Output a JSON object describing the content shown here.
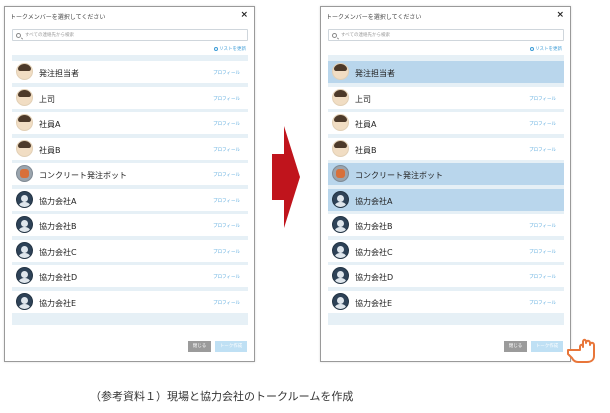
{
  "caption": "（参考資料１）現場と協力会社のトークルームを作成",
  "dialog": {
    "title": "トークメンバーを選択してください",
    "close": "×",
    "search_placeholder": "すべての連絡先から検索",
    "reset_link": "リストを更新",
    "profile_label": "プロフィール",
    "close_button": "閉じる",
    "create_button": "トーク作成"
  },
  "members": [
    {
      "name": "発注担当者",
      "avatar": "staff"
    },
    {
      "name": "上司",
      "avatar": "staff"
    },
    {
      "name": "社員A",
      "avatar": "staff"
    },
    {
      "name": "社員B",
      "avatar": "staff"
    },
    {
      "name": "コンクリート発注ボット",
      "avatar": "bot"
    },
    {
      "name": "協力会社A",
      "avatar": "partner"
    },
    {
      "name": "協力会社B",
      "avatar": "partner"
    },
    {
      "name": "協力会社C",
      "avatar": "partner"
    },
    {
      "name": "協力会社D",
      "avatar": "partner"
    },
    {
      "name": "協力会社E",
      "avatar": "partner"
    }
  ],
  "right_selected": [
    0,
    4,
    5
  ],
  "colors": {
    "arrow": "#c0141c",
    "selected_row": "#b9d6ec",
    "hand": "#e8763a",
    "link": "#5aa9dd"
  }
}
